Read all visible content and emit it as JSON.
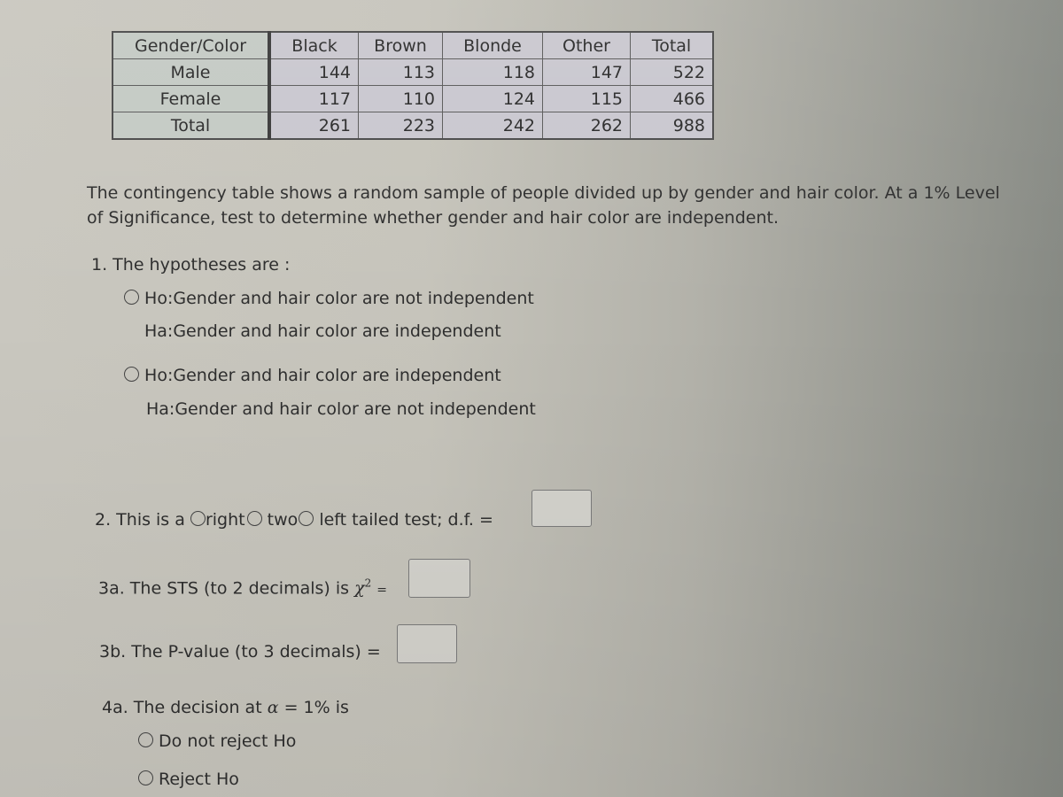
{
  "table": {
    "corner": "Gender/Color",
    "columns": [
      "Black",
      "Brown",
      "Blonde",
      "Other",
      "Total"
    ],
    "rows": [
      {
        "label": "Male",
        "values": [
          "144",
          "113",
          "118",
          "147",
          "522"
        ]
      },
      {
        "label": "Female",
        "values": [
          "117",
          "110",
          "124",
          "115",
          "466"
        ]
      },
      {
        "label": "Total",
        "values": [
          "261",
          "223",
          "242",
          "262",
          "988"
        ]
      }
    ]
  },
  "intro": {
    "line1": "The contingency table shows a random sample of people divided up by gender and hair color. At a 1% Level",
    "line2": "of Significance, test to determine whether gender and hair color are independent."
  },
  "q1": {
    "label": "1. The hypotheses are :",
    "options": [
      {
        "ho": "Ho:Gender and hair color are not independent",
        "ha": "Ha:Gender and hair color are independent",
        "selected": false
      },
      {
        "ho": "Ho:Gender and hair color are independent",
        "ha": "Ha:Gender and hair color are not independent",
        "selected": false
      }
    ]
  },
  "q2": {
    "prefix": "2. This is a",
    "options": [
      "right",
      "two",
      "left tailed test; d.f. ="
    ],
    "df_value": ""
  },
  "q3a": {
    "label": "3a. The STS (to 2 decimals) is",
    "symbol": "χ",
    "exponent": "2",
    "equals": "=",
    "value": ""
  },
  "q3b": {
    "label": "3b. The P-value (to 3 decimals) =",
    "value": ""
  },
  "q4a": {
    "label_prefix": "4a. The decision at",
    "alpha": "α",
    "label_suffix": "= 1% is",
    "options": [
      "Do not reject Ho",
      "Reject Ho"
    ]
  }
}
